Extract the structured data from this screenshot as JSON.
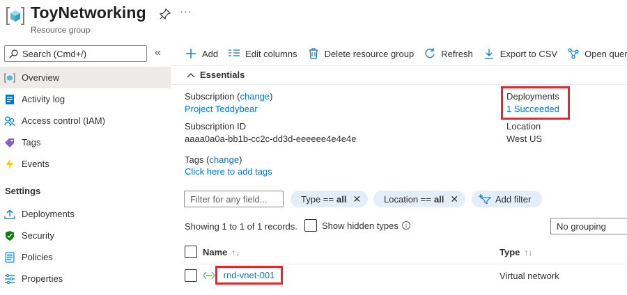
{
  "header": {
    "title": "ToyNetworking",
    "subtitle": "Resource group",
    "more": "···"
  },
  "sidebar": {
    "search_placeholder": "Search (Cmd+/)",
    "collapse": "«",
    "items": [
      {
        "label": "Overview",
        "icon": "resource-group-icon",
        "active": true
      },
      {
        "label": "Activity log",
        "icon": "activity-log-icon"
      },
      {
        "label": "Access control (IAM)",
        "icon": "people-icon"
      },
      {
        "label": "Tags",
        "icon": "tag-icon"
      },
      {
        "label": "Events",
        "icon": "lightning-icon"
      }
    ],
    "settings_heading": "Settings",
    "settings_items": [
      {
        "label": "Deployments",
        "icon": "upload-icon"
      },
      {
        "label": "Security",
        "icon": "shield-icon"
      },
      {
        "label": "Policies",
        "icon": "policy-icon"
      },
      {
        "label": "Properties",
        "icon": "properties-icon"
      }
    ]
  },
  "toolbar": {
    "add": "Add",
    "edit_columns": "Edit columns",
    "delete": "Delete resource group",
    "refresh": "Refresh",
    "export": "Export to CSV",
    "open_query": "Open query"
  },
  "essentials": {
    "heading": "Essentials",
    "subscription_label": "Subscription",
    "subscription_change_open": "(",
    "subscription_change": "change",
    "subscription_change_close": ")",
    "subscription_value": "Project Teddybear",
    "subscription_id_label": "Subscription ID",
    "subscription_id_value": "aaaa0a0a-bb1b-cc2c-dd3d-eeeeee4e4e4e",
    "tags_label": "Tags",
    "tags_change": "change",
    "tags_link": "Click here to add tags",
    "deployments_label": "Deployments",
    "deployments_value": "1 Succeeded",
    "location_label": "Location",
    "location_value": "West US"
  },
  "filters": {
    "placeholder": "Filter for any field...",
    "type_pill_key": "Type ==",
    "type_pill_val": "all",
    "location_pill_key": "Location ==",
    "location_pill_val": "all",
    "add_filter": "Add filter",
    "close": "✕"
  },
  "records": {
    "summary": "Showing 1 to 1 of 1 records.",
    "show_hidden": "Show hidden types",
    "info": "i",
    "grouping": "No grouping"
  },
  "table": {
    "col_name": "Name",
    "col_type": "Type",
    "sort": "↑↓",
    "rows": [
      {
        "name": "rnd-vnet-001",
        "type": "Virtual network"
      }
    ]
  },
  "colors": {
    "accent": "#0078d4",
    "highlight": "#e8262c",
    "pill": "#e3eef9"
  }
}
